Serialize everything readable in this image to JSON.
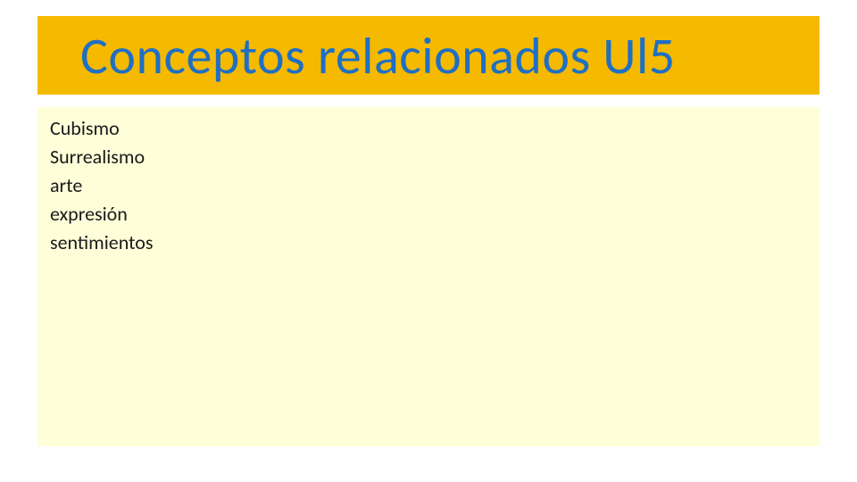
{
  "title": "Conceptos relacionados Ul5",
  "concepts": [
    "Cubismo",
    "Surrealismo",
    "arte",
    "expresión",
    "sentimientos"
  ]
}
